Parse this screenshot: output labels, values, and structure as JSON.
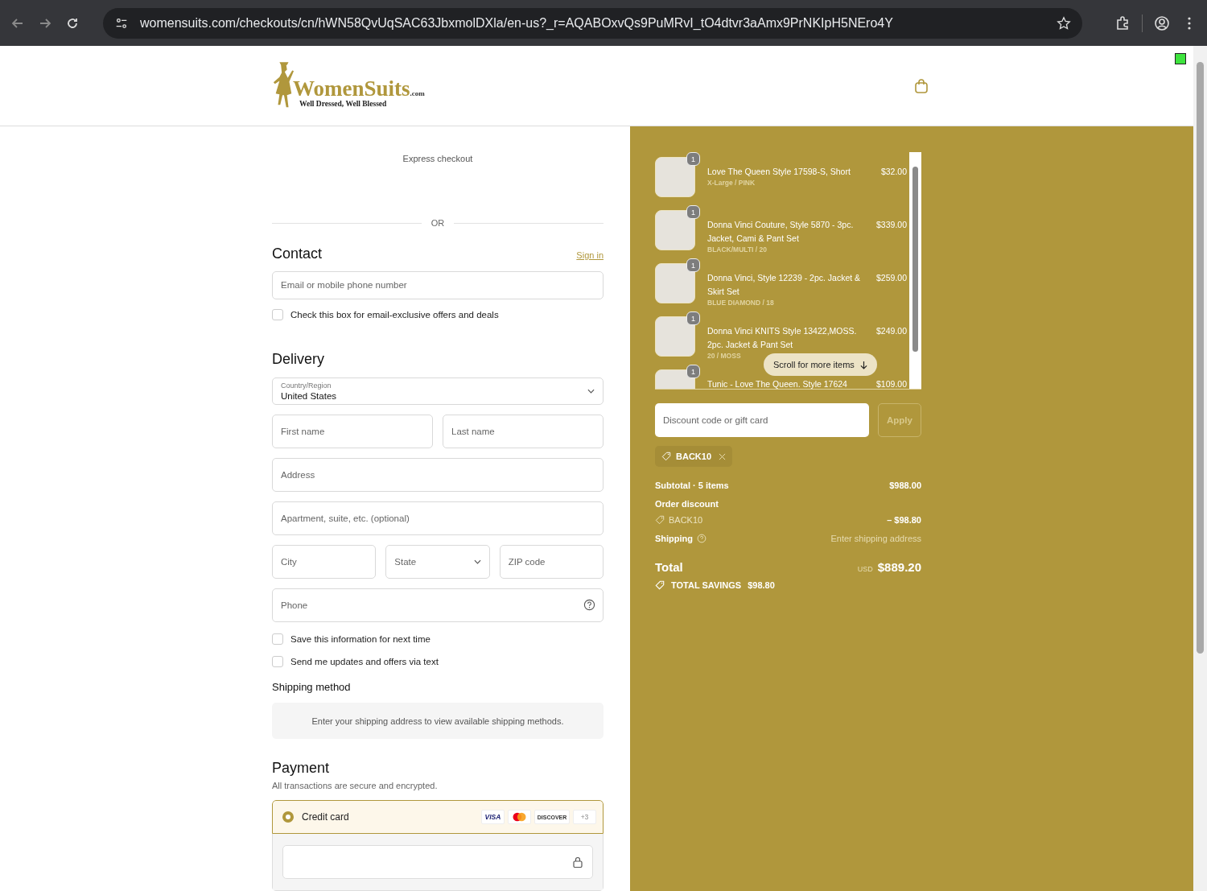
{
  "browser": {
    "url": "womensuits.com/checkouts/cn/hWN58QvUqSAC63JbxmolDXla/en-us?_r=AQABOxvQs9PuMRvI_tO4dtvr3aAmx9PrNKIpH5NEro4Y"
  },
  "logo": {
    "name": "WomenSuits",
    "suffix": ".com",
    "tagline": "Well Dressed, Well Blessed"
  },
  "checkout": {
    "express_label": "Express checkout",
    "divider_label": "OR",
    "contact": {
      "title": "Contact",
      "sign_in": "Sign in",
      "email_placeholder": "Email or mobile phone number",
      "offers": {
        "label": "Check this box for email-exclusive offers and deals",
        "checked": false
      }
    },
    "delivery": {
      "title": "Delivery",
      "country_label": "Country/Region",
      "country_value": "United States",
      "fields": [
        {
          "items": [
            {
              "kind": "text",
              "placeholder": "First name"
            },
            {
              "kind": "text",
              "placeholder": "Last name"
            }
          ]
        },
        {
          "items": [
            {
              "kind": "text",
              "placeholder": "Address"
            }
          ]
        },
        {
          "items": [
            {
              "kind": "text",
              "placeholder": "Apartment, suite, etc. (optional)"
            }
          ]
        },
        {
          "items": [
            {
              "kind": "text",
              "placeholder": "City"
            },
            {
              "kind": "select",
              "placeholder": "State"
            },
            {
              "kind": "text",
              "placeholder": "ZIP code"
            }
          ]
        },
        {
          "items": [
            {
              "kind": "help",
              "placeholder": "Phone"
            }
          ]
        }
      ],
      "options": [
        {
          "label": "Save this information for next time",
          "checked": false
        },
        {
          "label": "Send me updates and offers via text",
          "checked": false
        }
      ]
    },
    "shipping": {
      "title": "Shipping method",
      "notice": "Enter your shipping address to view available shipping methods."
    },
    "payment": {
      "title": "Payment",
      "subtitle": "All transactions are secure and encrypted.",
      "methods": [
        {
          "label": "Credit card",
          "selected": true,
          "cards": [
            {
              "kind": "visa",
              "label": "VISA"
            },
            {
              "kind": "mastercard"
            },
            {
              "kind": "discover",
              "label": "DISCOVER"
            },
            {
              "kind": "more",
              "label": "+3"
            }
          ]
        }
      ]
    }
  },
  "summary": {
    "items": [
      {
        "quantity": "1",
        "title": "Love The Queen Style 17598-S, Short",
        "variant": "X-Large / PINK",
        "price": "$32.00"
      },
      {
        "quantity": "1",
        "title": "Donna Vinci Couture, Style 5870 - 3pc. Jacket, Cami & Pant Set",
        "variant": "BLACK/MULTI / 20",
        "price": "$339.00"
      },
      {
        "quantity": "1",
        "title": "Donna Vinci, Style 12239 - 2pc. Jacket & Skirt Set",
        "variant": "BLUE DIAMOND / 18",
        "price": "$259.00"
      },
      {
        "quantity": "1",
        "title": "Donna Vinci KNITS Style 13422,MOSS. 2pc. Jacket & Pant Set",
        "variant": "20 / MOSS",
        "price": "$249.00"
      },
      {
        "quantity": "1",
        "title": "Tunic - Love The Queen. Style 17624",
        "price": "$109.00"
      }
    ],
    "scroll_hint": "Scroll for more items",
    "discount_placeholder": "Discount code or gift card",
    "apply": "Apply",
    "code": "BACK10",
    "subtotal_label": "Subtotal · 5 items",
    "subtotal": "$988.00",
    "discount_label": "Order discount",
    "discount_code": "BACK10",
    "discount_amount": "– $98.80",
    "shipping_label": "Shipping",
    "shipping_value": "Enter shipping address",
    "total_label": "Total",
    "currency": "USD",
    "total": "$889.20",
    "savings_label": "TOTAL SAVINGS",
    "savings": "$98.80"
  }
}
